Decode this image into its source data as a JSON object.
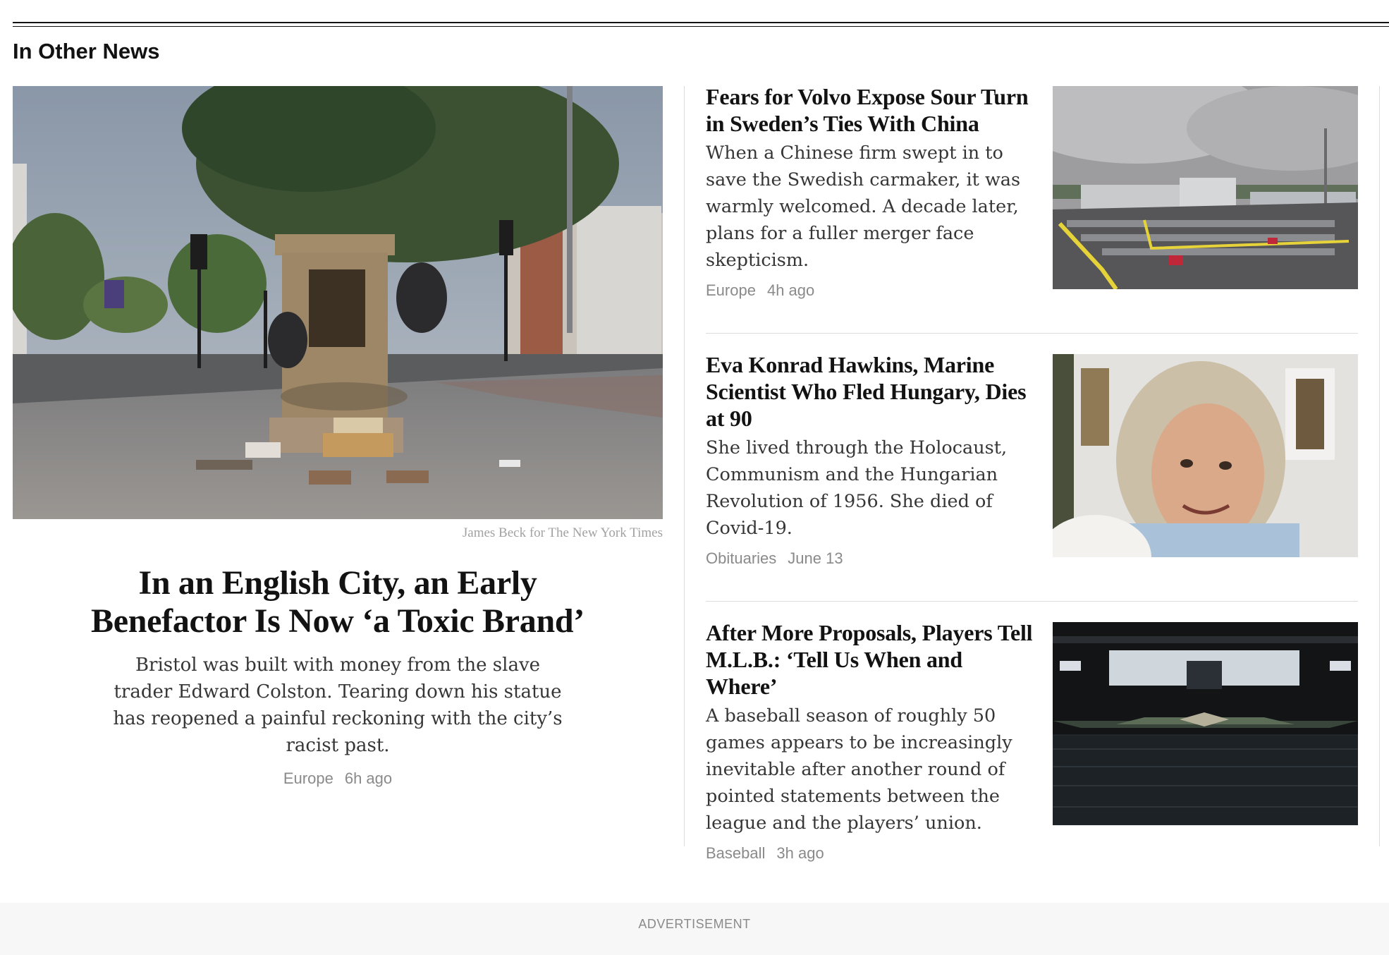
{
  "section": {
    "title": "In Other News"
  },
  "lead": {
    "photo_alt": "Empty pedestal of a toppled statue with protest signs in a city square",
    "credit": "James Beck for The New York Times",
    "headline": "In an English City, an Early Benefactor Is Now ‘a Toxic Brand’",
    "summary": "Bristol was built with money from the slave trader Edward Colston. Tearing down his statue has reopened a painful reckoning with the city’s racist past.",
    "section": "Europe",
    "time": "6h ago"
  },
  "stories": [
    {
      "headline": "Fears for Volvo Expose Sour Turn in Sweden’s Ties With China",
      "summary": "When a Chinese firm swept in to save the Swedish carmaker, it was warmly welcomed. A decade later, plans for a fuller merger face skepticism.",
      "section": "Europe",
      "time": "4h ago"
    },
    {
      "headline": "Eva Konrad Hawkins, Marine Scientist Who Fled Hungary, Dies at 90",
      "summary": "She lived through the Holocaust, Communism and the Hungarian Revolution of 1956. She died of Covid-19.",
      "section": "Obituaries",
      "time": "June 13"
    },
    {
      "headline": "After More Proposals, Players Tell M.L.B.: ‘Tell Us When and Where’",
      "summary": "A baseball season of roughly 50 games appears to be increasingly inevitable after another round of pointed statements between the league and the players’ union.",
      "section": "Baseball",
      "time": "3h ago"
    }
  ],
  "ad": {
    "label": "ADVERTISEMENT"
  }
}
